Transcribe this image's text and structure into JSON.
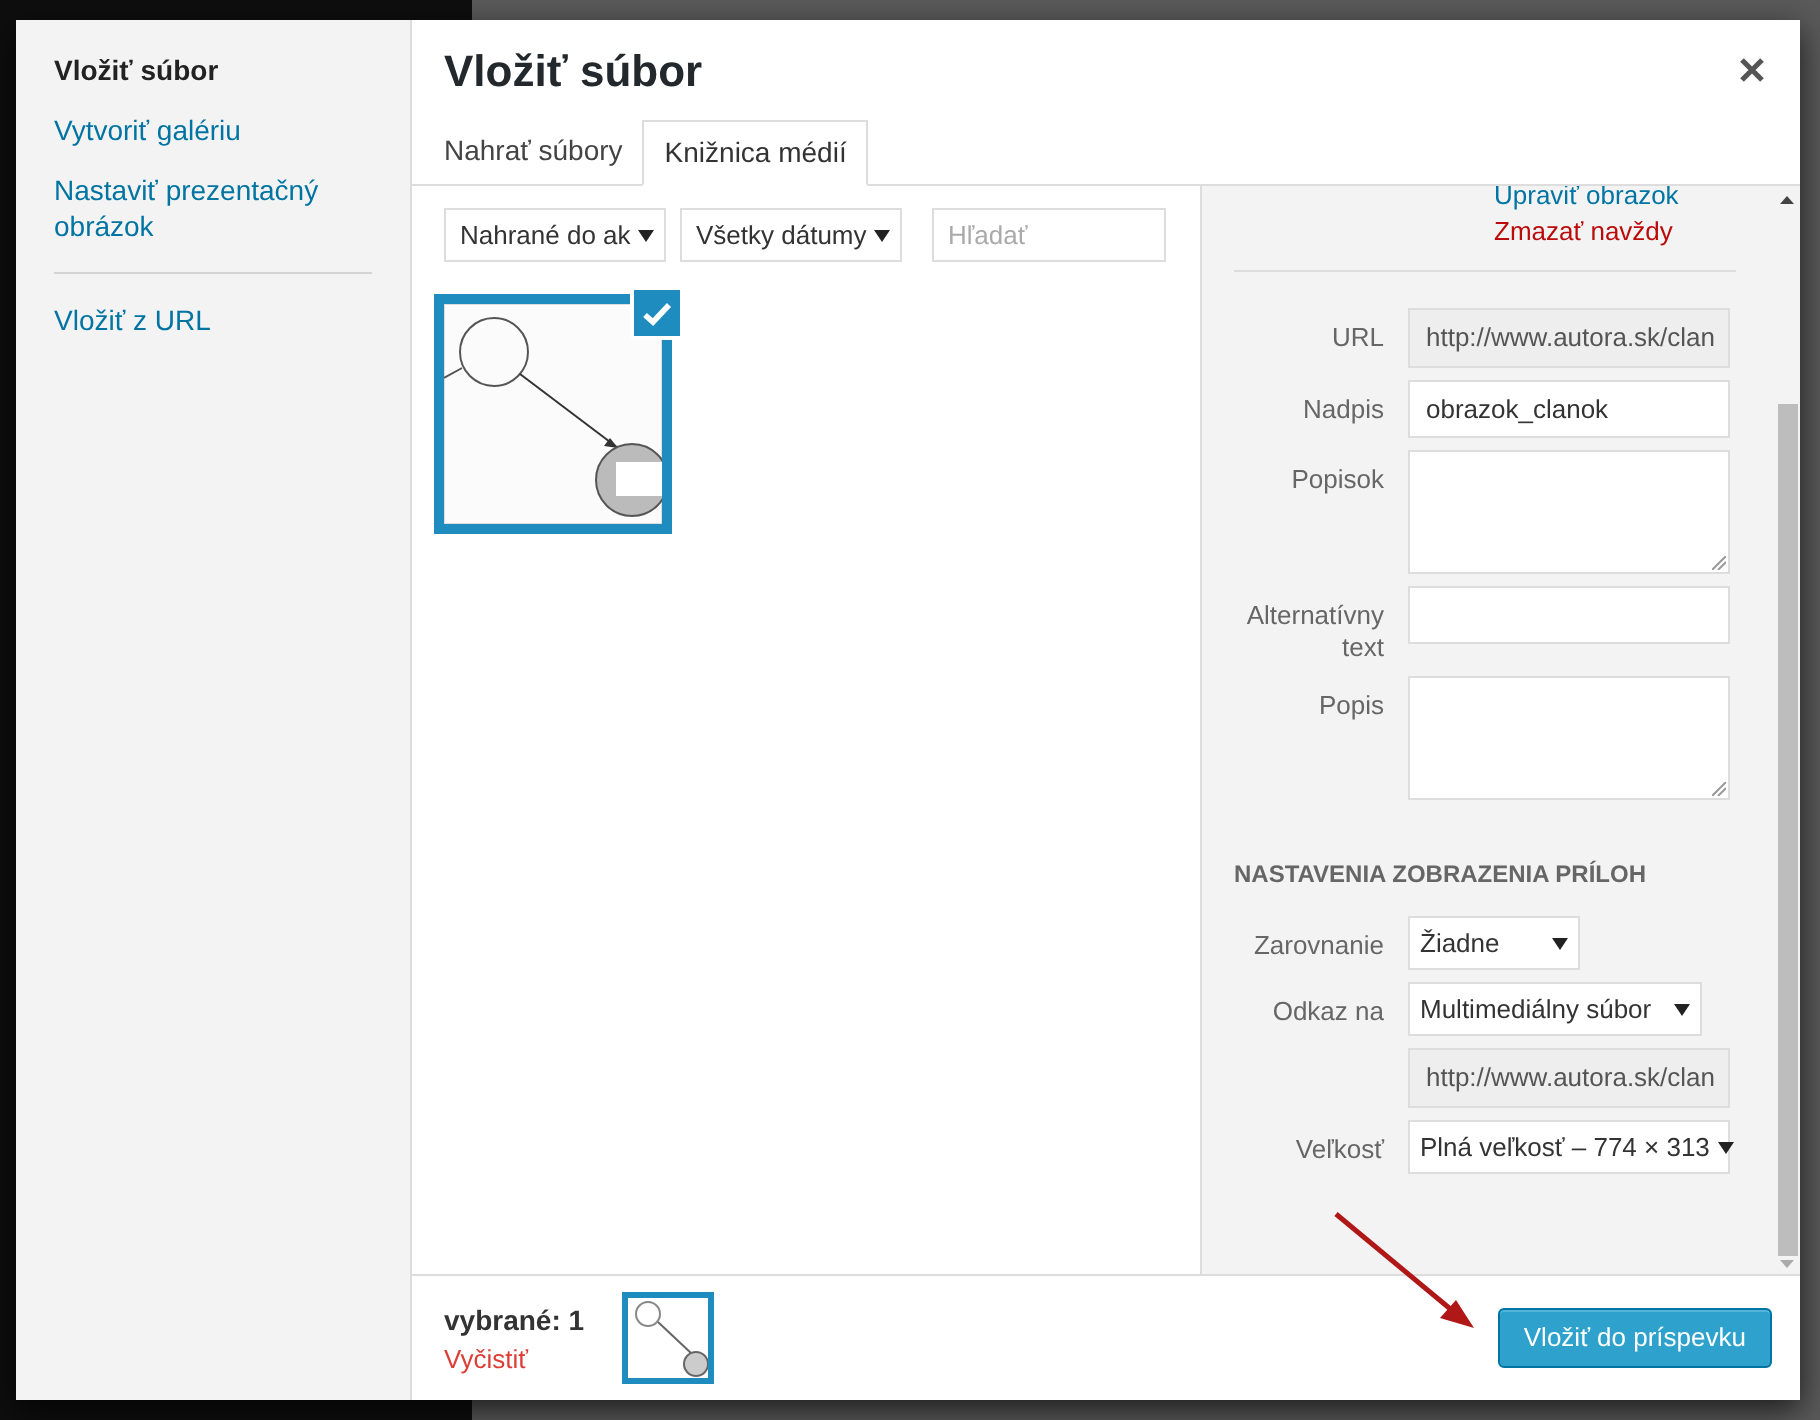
{
  "modal": {
    "menu_groups": [
      [
        {
          "label": "Vložiť súbor",
          "selected": true
        },
        {
          "label": "Vytvoriť galériu",
          "selected": false
        },
        {
          "label": "Nastaviť prezentačný obrázok",
          "selected": false
        }
      ],
      [
        {
          "label": "Vložiť z URL",
          "selected": false
        }
      ]
    ],
    "title": "Vložiť súbor",
    "tabs": [
      {
        "label": "Nahrať súbory",
        "selected": false
      },
      {
        "label": "Knižnica médií",
        "selected": true
      }
    ],
    "filters": [
      {
        "value": "Nahrané do ak"
      },
      {
        "value": "Všetky dátumy"
      }
    ],
    "search": {
      "placeholder": "Hľadať"
    },
    "attachments": [
      {
        "selected": true,
        "checked": true
      }
    ],
    "details": {
      "links": [
        {
          "label": "Upraviť obrazok",
          "kind": "edit"
        },
        {
          "label": "Zmazať navždy",
          "kind": "delete"
        }
      ],
      "fields": [
        {
          "label": "URL",
          "kind": "readonly",
          "value": "http://www.autora.sk/clan"
        },
        {
          "label": "Nadpis",
          "kind": "text",
          "value": "obrazok_clanok"
        },
        {
          "label": "Popisok",
          "kind": "textarea"
        },
        {
          "label": "Alternatívny text",
          "kind": "text"
        },
        {
          "label": "Popis",
          "kind": "textarea"
        }
      ],
      "settings_heading": "NASTAVENIA ZOBRAZENIA PRÍLOH",
      "settings": [
        {
          "label": "Zarovnanie",
          "kind": "select",
          "value": "Žiadne"
        },
        {
          "label": "Odkaz na",
          "kind": "select",
          "value": "Multimediálny súbor"
        },
        {
          "kind": "readonly",
          "value": "http://www.autora.sk/clan"
        },
        {
          "label": "Veľkosť",
          "kind": "select",
          "value": "Plná veľkosť – 774 × 313"
        }
      ]
    },
    "footer": {
      "selected_count": "vybrané: 1",
      "clear": "Vyčistiť",
      "insert_button": "Vložiť do príspevku"
    }
  }
}
